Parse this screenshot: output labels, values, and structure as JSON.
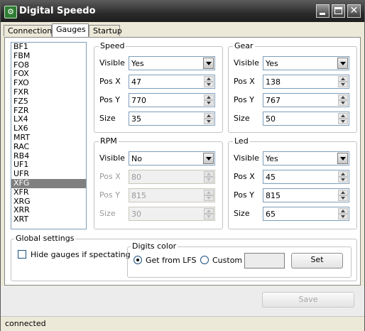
{
  "window": {
    "title": "Digital Speedo",
    "icon": "speedo-app-icon",
    "close_glyph": "✕"
  },
  "tabs": [
    {
      "label": "Connection",
      "active": false
    },
    {
      "label": "Gauges",
      "active": true
    },
    {
      "label": "Startup",
      "active": false
    }
  ],
  "cars": [
    "BF1",
    "FBM",
    "FO8",
    "FOX",
    "FXO",
    "FXR",
    "FZ5",
    "FZR",
    "LX4",
    "LX6",
    "MRT",
    "RAC",
    "RB4",
    "UF1",
    "UFR",
    "XFG",
    "XFR",
    "XRG",
    "XRR",
    "XRT"
  ],
  "selected_car": "XFG",
  "speed": {
    "title": "Speed",
    "visible_label": "Visible",
    "visible_value": "Yes",
    "posx_label": "Pos X",
    "posx_value": "47",
    "posy_label": "Pos Y",
    "posy_value": "770",
    "size_label": "Size",
    "size_value": "35"
  },
  "gear": {
    "title": "Gear",
    "visible_label": "Visible",
    "visible_value": "Yes",
    "posx_label": "Pos X",
    "posx_value": "138",
    "posy_label": "Pos Y",
    "posy_value": "767",
    "size_label": "Size",
    "size_value": "50"
  },
  "rpm": {
    "title": "RPM",
    "visible_label": "Visible",
    "visible_value": "No",
    "posx_label": "Pos X",
    "posx_value": "80",
    "posy_label": "Pos Y",
    "posy_value": "815",
    "size_label": "Size",
    "size_value": "30"
  },
  "led": {
    "title": "Led",
    "visible_label": "Visible",
    "visible_value": "Yes",
    "posx_label": "Pos X",
    "posx_value": "45",
    "posy_label": "Pos Y",
    "posy_value": "815",
    "size_label": "Size",
    "size_value": "65"
  },
  "global": {
    "title": "Global settings",
    "hide_label": "Hide gauges if spectating",
    "hide_checked": false,
    "digits": {
      "title": "Digits color",
      "get_from_lfs_label": "Get from LFS",
      "custom_label": "Custom",
      "selected": "Get from LFS",
      "set_label": "Set"
    }
  },
  "save_label": "Save",
  "status": "connected",
  "colors": {
    "titlebar": "#2b2b2b",
    "selection": "#808080",
    "field_border": "#7f9db9"
  }
}
